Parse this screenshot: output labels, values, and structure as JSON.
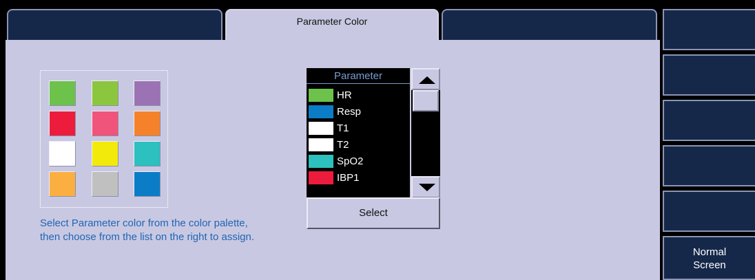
{
  "tabs": [
    {
      "label": ""
    },
    {
      "label": "Parameter Color"
    },
    {
      "label": ""
    }
  ],
  "palette": {
    "colors": [
      "#6cc24a",
      "#8cc63f",
      "#9b73b4",
      "#ed1c3c",
      "#f0547a",
      "#f5822a",
      "#ffffff",
      "#f2ea0a",
      "#2cc0be",
      "#fbaf41",
      "#c0c0c0",
      "#0a7dc6"
    ]
  },
  "instructions": {
    "line1": "Select Parameter color from the color palette,",
    "line2": "then choose from the list on the right to assign."
  },
  "parameter_list": {
    "header": "Parameter",
    "items": [
      {
        "name": "HR",
        "color": "#6cc24a"
      },
      {
        "name": "Resp",
        "color": "#0a7dc6"
      },
      {
        "name": "T1",
        "color": "#ffffff"
      },
      {
        "name": "T2",
        "color": "#ffffff"
      },
      {
        "name": "SpO2",
        "color": "#2cc0be"
      },
      {
        "name": "IBP1",
        "color": "#ed1c3c"
      }
    ]
  },
  "scroll": {
    "up_icon": "triangle-up-icon",
    "down_icon": "triangle-down-icon"
  },
  "select_button": {
    "label": "Select"
  },
  "side_buttons": [
    {
      "label": ""
    },
    {
      "label": ""
    },
    {
      "label": ""
    },
    {
      "label": ""
    },
    {
      "label": ""
    },
    {
      "label_line1": "Normal",
      "label_line2": "Screen"
    }
  ]
}
